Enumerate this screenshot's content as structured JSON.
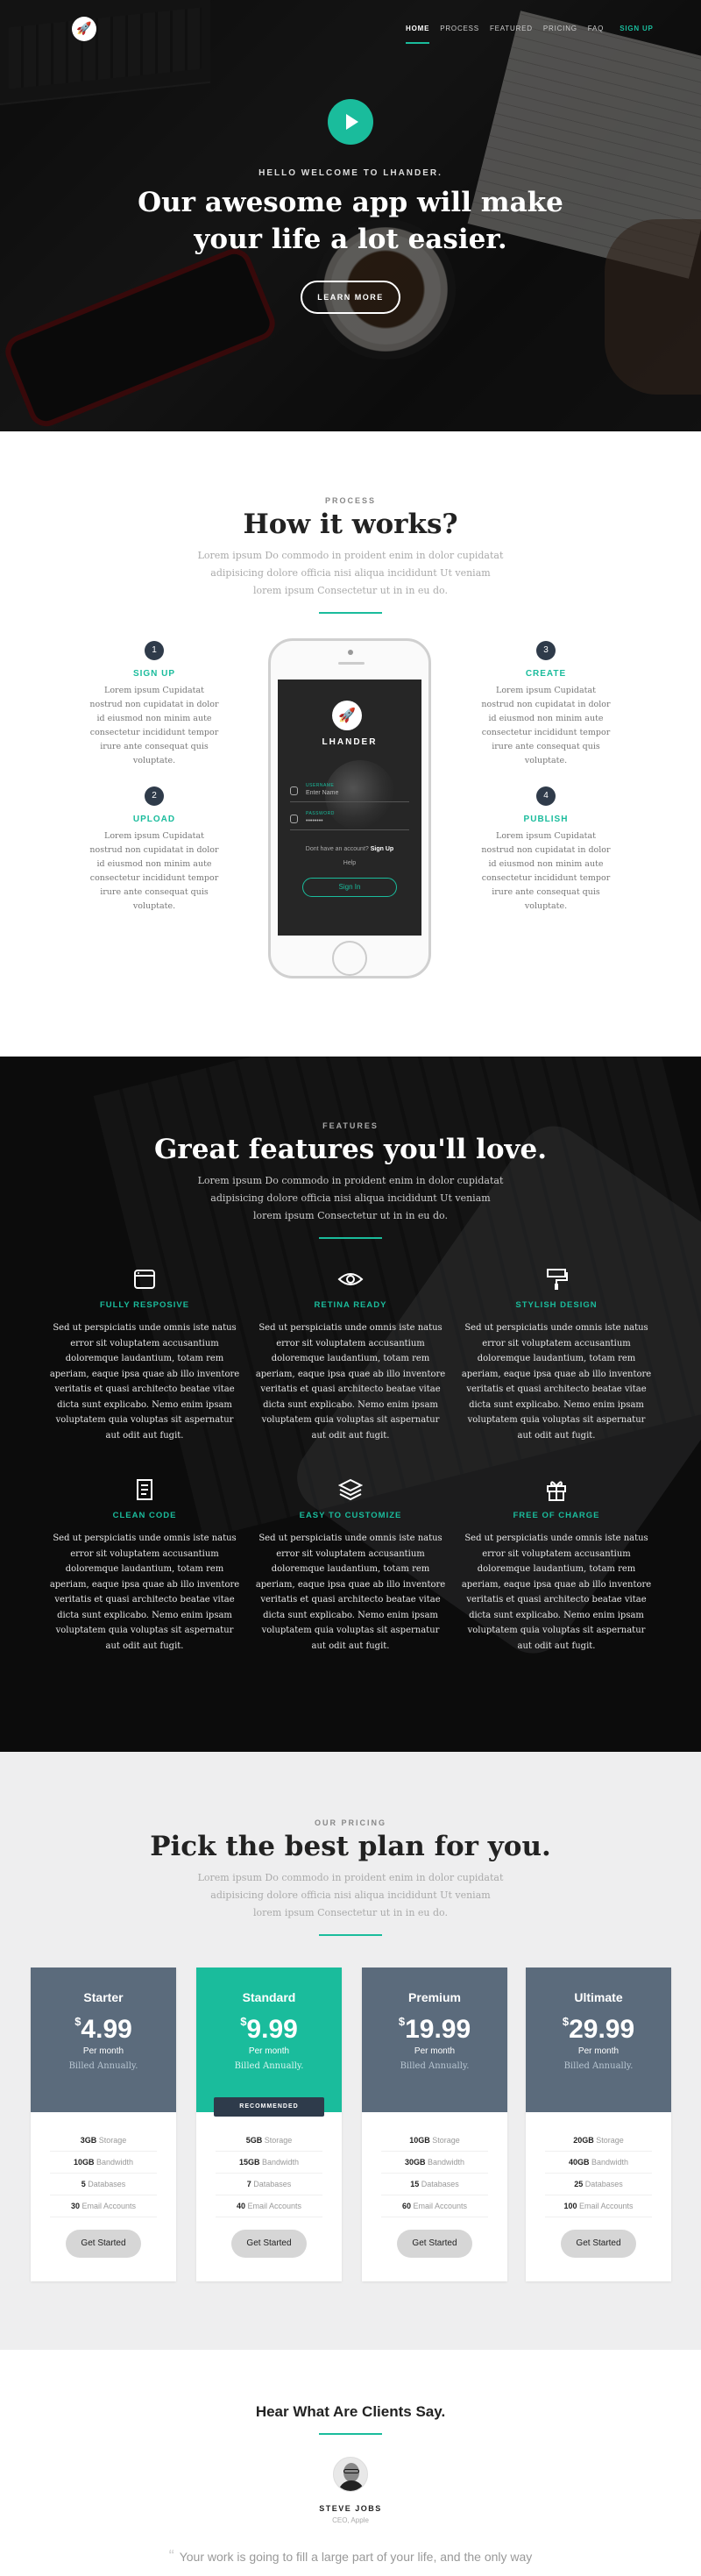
{
  "nav": {
    "logo_glyph": "🚀",
    "items": [
      {
        "label": "HOME",
        "active": true
      },
      {
        "label": "PROCESS"
      },
      {
        "label": "FEATURED"
      },
      {
        "label": "PRICING"
      },
      {
        "label": "FAQ"
      }
    ],
    "cta": "SIGN UP"
  },
  "hero": {
    "kicker": "HELLO WELCOME TO LHANDER.",
    "title": "Our awesome app will make your life a lot easier.",
    "button": "LEARN MORE"
  },
  "process": {
    "kicker": "PROCESS",
    "title": "How it works?",
    "subtitle": "Lorem ipsum Do commodo in proident enim in dolor cupidatat adipisicing dolore officia nisi aliqua incididunt Ut veniam lorem ipsum Consectetur ut in in eu do.",
    "steps": [
      {
        "num": "1",
        "title": "SIGN UP",
        "text": "Lorem ipsum Cupidatat nostrud non cupidatat in dolor id eiusmod non minim aute consectetur incididunt tempor irure ante consequat quis voluptate."
      },
      {
        "num": "2",
        "title": "UPLOAD",
        "text": "Lorem ipsum Cupidatat nostrud non cupidatat in dolor id eiusmod non minim aute consectetur incididunt tempor irure ante consequat quis voluptate."
      },
      {
        "num": "3",
        "title": "CREATE",
        "text": "Lorem ipsum Cupidatat nostrud non cupidatat in dolor id eiusmod non minim aute consectetur incididunt tempor irure ante consequat quis voluptate."
      },
      {
        "num": "4",
        "title": "PUBLISH",
        "text": "Lorem ipsum Cupidatat nostrud non cupidatat in dolor id eiusmod non minim aute consectetur incididunt tempor irure ante consequat quis voluptate."
      }
    ],
    "phone": {
      "app_name": "LHANDER",
      "username_label": "USERNAME",
      "username_value": "Enter Name",
      "password_label": "PASSWORD",
      "password_value": "••••••••",
      "no_account": "Dont have an account?",
      "signup_link": "Sign Up",
      "help": "Help",
      "signin": "Sign In"
    }
  },
  "features": {
    "kicker": "FEATURES",
    "title": "Great features you'll love.",
    "subtitle": "Lorem ipsum Do commodo in proident enim in dolor cupidatat adipisicing dolore officia nisi aliqua incididunt Ut veniam lorem ipsum Consectetur ut in in eu do.",
    "items": [
      {
        "icon": "browser-window-icon",
        "title": "FULLY RESPOSIVE",
        "text": "Sed ut perspiciatis unde omnis iste natus error sit voluptatem accusantium doloremque laudantium, totam rem aperiam, eaque ipsa quae ab illo inventore veritatis et quasi architecto beatae vitae dicta sunt explicabo. Nemo enim ipsam voluptatem quia voluptas sit aspernatur aut odit aut fugit."
      },
      {
        "icon": "eye-icon",
        "title": "RETINA READY",
        "text": "Sed ut perspiciatis unde omnis iste natus error sit voluptatem accusantium doloremque laudantium, totam rem aperiam, eaque ipsa quae ab illo inventore veritatis et quasi architecto beatae vitae dicta sunt explicabo. Nemo enim ipsam voluptatem quia voluptas sit aspernatur aut odit aut fugit."
      },
      {
        "icon": "paint-roller-icon",
        "title": "STYLISH DESIGN",
        "text": "Sed ut perspiciatis unde omnis iste natus error sit voluptatem accusantium doloremque laudantium, totam rem aperiam, eaque ipsa quae ab illo inventore veritatis et quasi architecto beatae vitae dicta sunt explicabo. Nemo enim ipsam voluptatem quia voluptas sit aspernatur aut odit aut fugit."
      },
      {
        "icon": "document-icon",
        "title": "CLEAN CODE",
        "text": "Sed ut perspiciatis unde omnis iste natus error sit voluptatem accusantium doloremque laudantium, totam rem aperiam, eaque ipsa quae ab illo inventore veritatis et quasi architecto beatae vitae dicta sunt explicabo. Nemo enim ipsam voluptatem quia voluptas sit aspernatur aut odit aut fugit."
      },
      {
        "icon": "layers-icon",
        "title": "EASY TO CUSTOMIZE",
        "text": "Sed ut perspiciatis unde omnis iste natus error sit voluptatem accusantium doloremque laudantium, totam rem aperiam, eaque ipsa quae ab illo inventore veritatis et quasi architecto beatae vitae dicta sunt explicabo. Nemo enim ipsam voluptatem quia voluptas sit aspernatur aut odit aut fugit."
      },
      {
        "icon": "gift-icon",
        "title": "FREE OF CHARGE",
        "text": "Sed ut perspiciatis unde omnis iste natus error sit voluptatem accusantium doloremque laudantium, totam rem aperiam, eaque ipsa quae ab illo inventore veritatis et quasi architecto beatae vitae dicta sunt explicabo. Nemo enim ipsam voluptatem quia voluptas sit aspernatur aut odit aut fugit."
      }
    ]
  },
  "pricing": {
    "kicker": "OUR PRICING",
    "title": "Pick the best plan for you.",
    "subtitle": "Lorem ipsum Do commodo in proident enim in dolor cupidatat adipisicing dolore officia nisi aliqua incididunt Ut veniam lorem ipsum Consectetur ut in in eu do.",
    "plans": [
      {
        "name": "Starter",
        "currency": "$",
        "price": "4.99",
        "period": "Per month",
        "billing": "Billed Annually.",
        "recommended": "",
        "features": [
          {
            "v": "3GB",
            "l": "Storage"
          },
          {
            "v": "10GB",
            "l": "Bandwidth"
          },
          {
            "v": "5",
            "l": "Databases"
          },
          {
            "v": "30",
            "l": "Email Accounts"
          }
        ],
        "button": "Get Started"
      },
      {
        "name": "Standard",
        "currency": "$",
        "price": "9.99",
        "period": "Per month",
        "billing": "Billed Annually.",
        "recommended": "RECOMMENDED",
        "features": [
          {
            "v": "5GB",
            "l": "Storage"
          },
          {
            "v": "15GB",
            "l": "Bandwidth"
          },
          {
            "v": "7",
            "l": "Databases"
          },
          {
            "v": "40",
            "l": "Email Accounts"
          }
        ],
        "button": "Get Started"
      },
      {
        "name": "Premium",
        "currency": "$",
        "price": "19.99",
        "period": "Per month",
        "billing": "Billed Annually.",
        "recommended": "",
        "features": [
          {
            "v": "10GB",
            "l": "Storage"
          },
          {
            "v": "30GB",
            "l": "Bandwidth"
          },
          {
            "v": "15",
            "l": "Databases"
          },
          {
            "v": "60",
            "l": "Email Accounts"
          }
        ],
        "button": "Get Started"
      },
      {
        "name": "Ultimate",
        "currency": "$",
        "price": "29.99",
        "period": "Per month",
        "billing": "Billed Annually.",
        "recommended": "",
        "features": [
          {
            "v": "20GB",
            "l": "Storage"
          },
          {
            "v": "40GB",
            "l": "Bandwidth"
          },
          {
            "v": "25",
            "l": "Databases"
          },
          {
            "v": "100",
            "l": "Email Accounts"
          }
        ],
        "button": "Get Started"
      }
    ]
  },
  "testimonials": {
    "title": "Hear What Are Clients Say.",
    "name": "STEVE JOBS",
    "role": "CEO, Apple",
    "quote_mark": "“",
    "quote": "Your work is going to fill a large part of your life, and the only way"
  },
  "colors": {
    "accent": "#1abc9c",
    "plan_header": "#5b6b7c",
    "dark_badge": "#2e3b4b"
  }
}
